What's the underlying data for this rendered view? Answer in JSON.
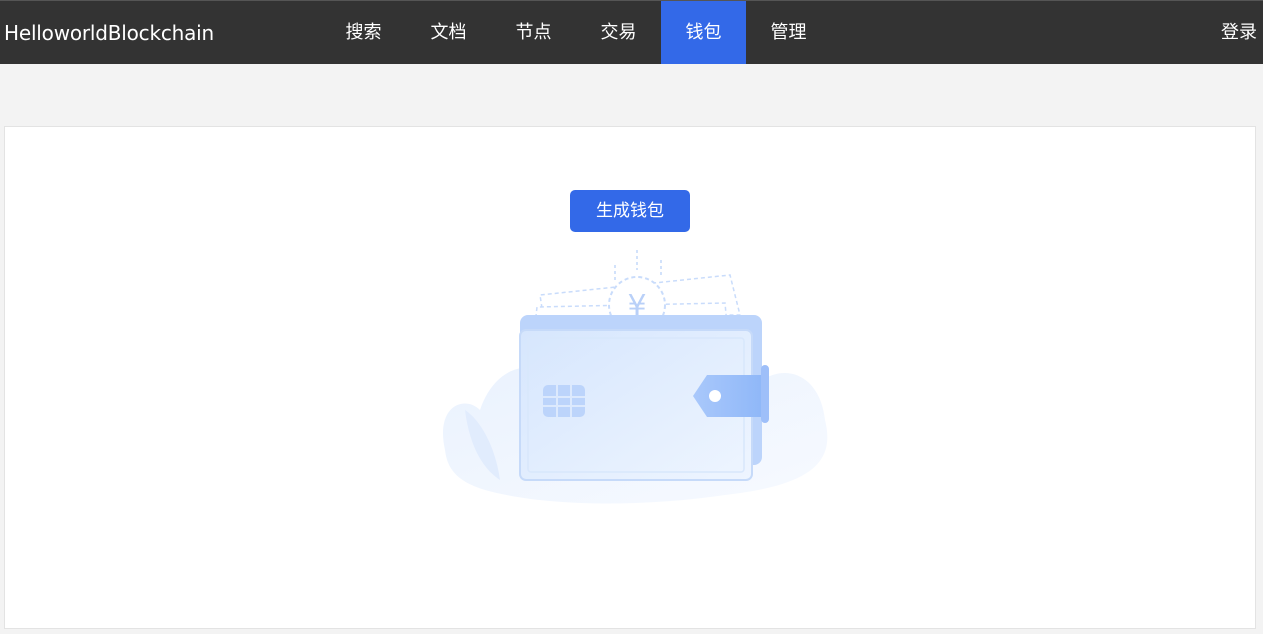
{
  "header": {
    "brand": "HelloworldBlockchain",
    "nav": [
      {
        "label": "搜索",
        "active": false
      },
      {
        "label": "文档",
        "active": false
      },
      {
        "label": "节点",
        "active": false
      },
      {
        "label": "交易",
        "active": false
      },
      {
        "label": "钱包",
        "active": true
      },
      {
        "label": "管理",
        "active": false
      }
    ],
    "login_label": "登录"
  },
  "main": {
    "generate_wallet_label": "生成钱包",
    "illustration": "wallet-icon",
    "coin_symbol": "¥"
  },
  "colors": {
    "topbar": "#333333",
    "accent": "#3369e8",
    "page_bg": "#f3f3f3",
    "card_bg": "#ffffff"
  }
}
